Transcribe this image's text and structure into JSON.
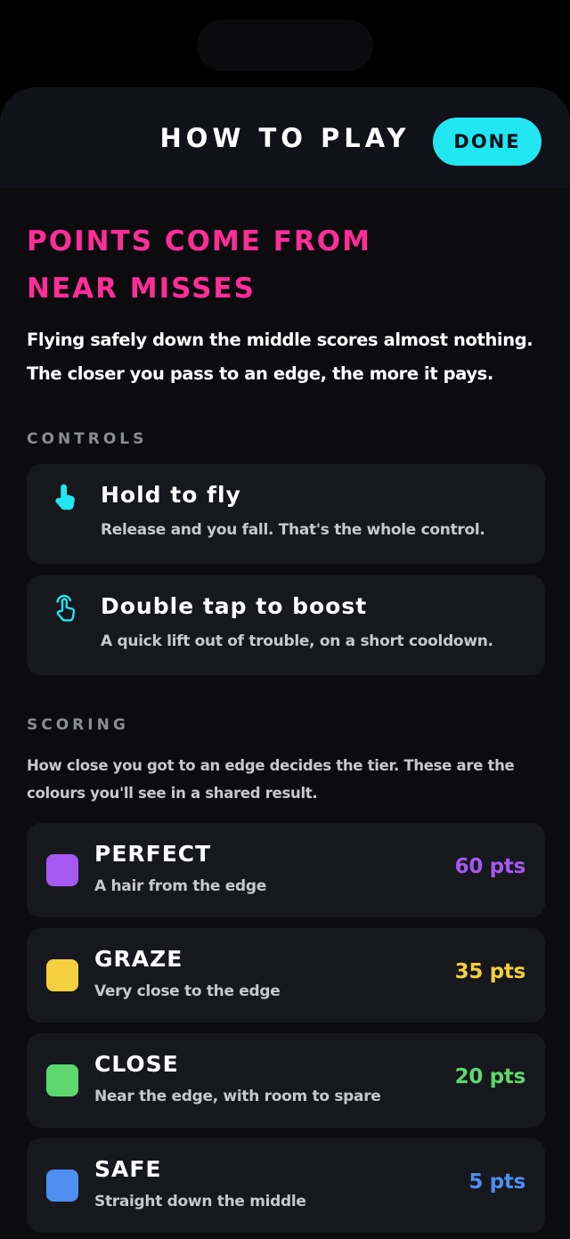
{
  "header": {
    "title": "HOW TO PLAY",
    "done_label": "DONE"
  },
  "hero": {
    "title": "POINTS COME FROM NEAR MISSES",
    "subtitle": "Flying safely down the middle scores almost nothing. The closer you pass to an edge, the more it pays."
  },
  "controls": {
    "label": "CONTROLS",
    "items": [
      {
        "title": "Hold to fly",
        "desc": "Release and you fall. That's the whole control.",
        "icon": "hand-pointer-icon"
      },
      {
        "title": "Double tap to boost",
        "desc": "A quick lift out of trouble, on a short cooldown.",
        "icon": "hand-double-tap-icon"
      }
    ]
  },
  "scoring": {
    "label": "SCORING",
    "desc": "How close you got to an edge decides the tier. These are the colours you'll see in a shared result.",
    "tiers": [
      {
        "name": "PERFECT",
        "desc": "A hair from the edge",
        "points": "60 pts",
        "color": "#a659f2"
      },
      {
        "name": "GRAZE",
        "desc": "Very close to the edge",
        "points": "35 pts",
        "color": "#f4cf3e"
      },
      {
        "name": "CLOSE",
        "desc": "Near the edge, with room to spare",
        "points": "20 pts",
        "color": "#5ed86e"
      },
      {
        "name": "SAFE",
        "desc": "Straight down the middle",
        "points": "5 pts",
        "color": "#4e8ff1"
      }
    ]
  },
  "colors": {
    "accent_cyan": "#22e6f2",
    "accent_pink": "#ff2e96"
  }
}
